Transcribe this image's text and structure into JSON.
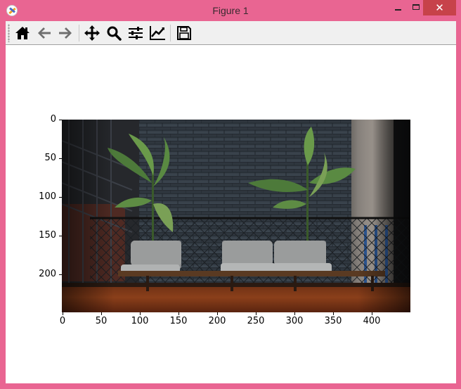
{
  "window": {
    "title": "Figure 1",
    "min_icon": "minimize-icon",
    "max_icon": "maximize-icon",
    "close_icon": "close-icon",
    "close_glyph": "✕",
    "colors": {
      "frame": "#e96592",
      "close": "#c7424a",
      "toolbar": "#f0f0f0"
    }
  },
  "toolbar": {
    "buttons": [
      {
        "name": "home-button",
        "icon": "home-icon"
      },
      {
        "name": "back-button",
        "icon": "arrow-left-icon"
      },
      {
        "name": "forward-button",
        "icon": "arrow-right-icon"
      },
      {
        "name": "pan-button",
        "icon": "move-icon"
      },
      {
        "name": "zoom-button",
        "icon": "magnifier-icon"
      },
      {
        "name": "configure-subplots-button",
        "icon": "sliders-icon"
      },
      {
        "name": "edit-axis-button",
        "icon": "line-chart-icon"
      },
      {
        "name": "save-button",
        "icon": "floppy-disk-icon"
      }
    ]
  },
  "plot": {
    "image_description": "photo of two banana-leaf plants and three gray cushioned chairs in front of a brick wall",
    "x_ticks": [
      "0",
      "50",
      "100",
      "150",
      "200",
      "250",
      "300",
      "350",
      "400"
    ],
    "y_ticks": [
      "0",
      "50",
      "100",
      "150",
      "200"
    ],
    "x_range": [
      0,
      450
    ],
    "y_range": [
      0,
      250
    ]
  }
}
